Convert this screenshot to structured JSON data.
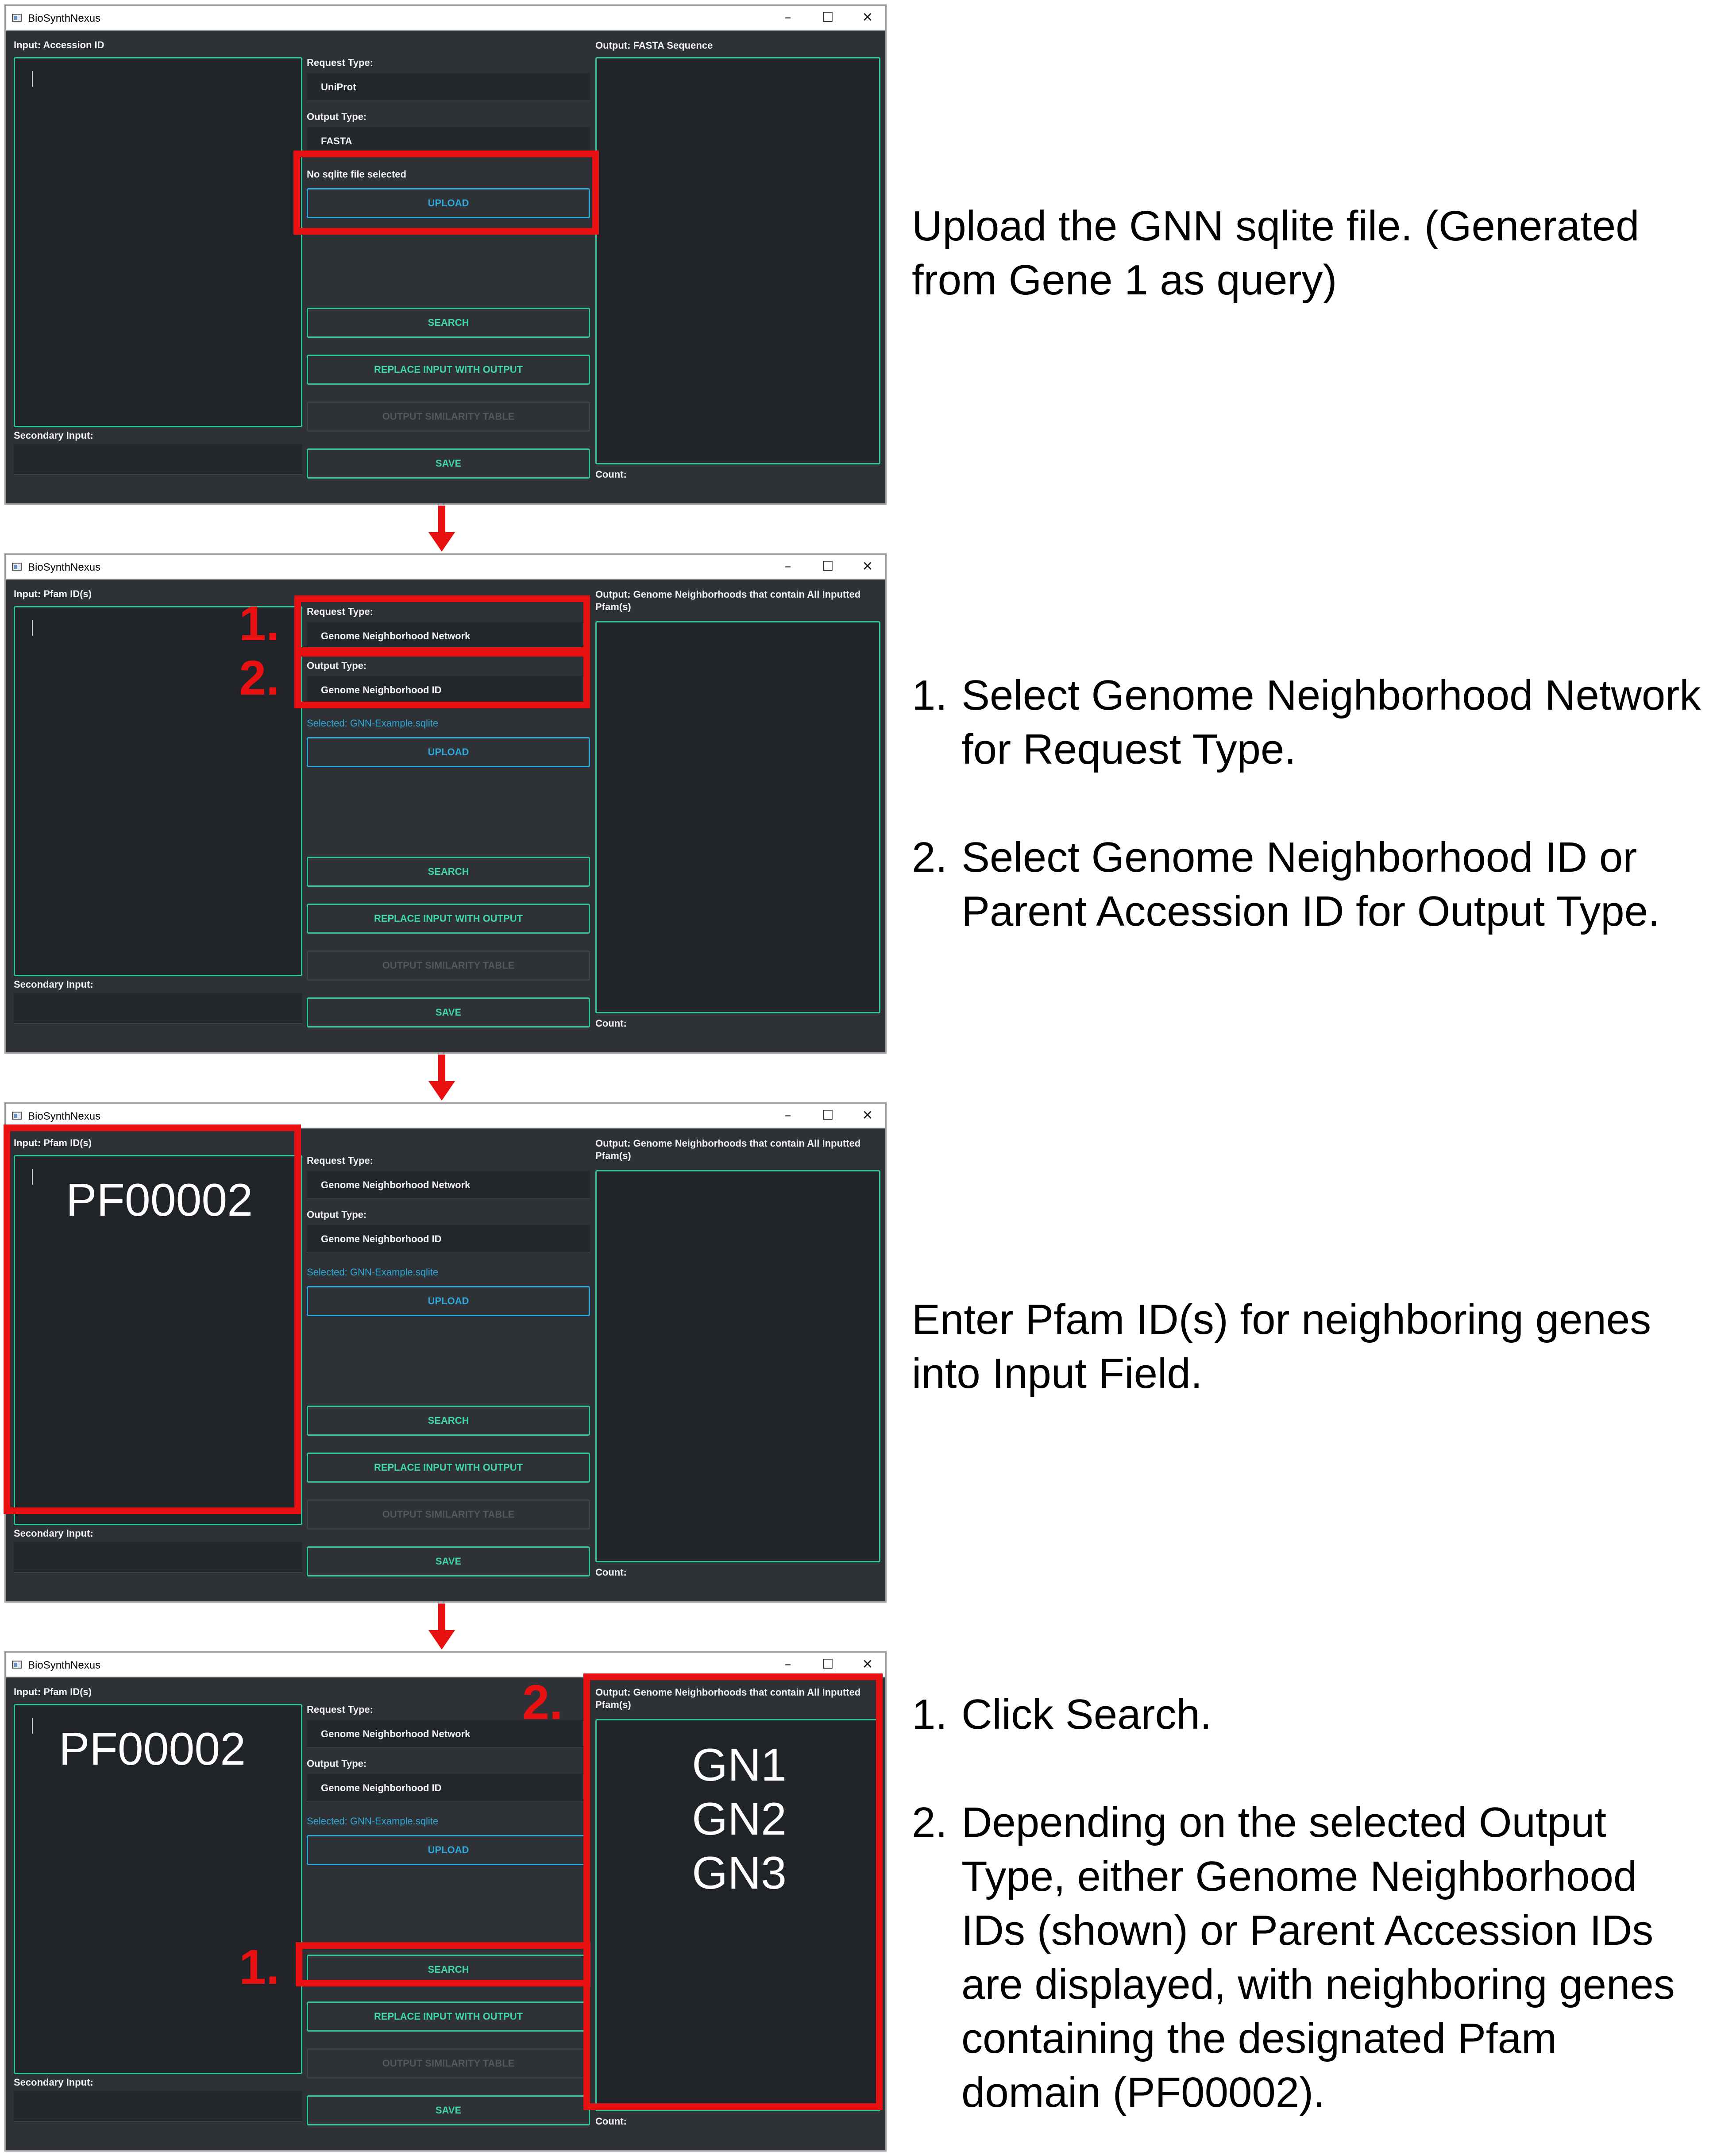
{
  "app_title": "BioSynthNexus",
  "window_controls": {
    "minimize": "–",
    "maximize": "☐",
    "close": "✕"
  },
  "labels": {
    "request_type": "Request Type:",
    "output_type": "Output Type:",
    "secondary_input": "Secondary Input:",
    "count": "Count:"
  },
  "buttons": {
    "upload": "UPLOAD",
    "search": "SEARCH",
    "replace": "REPLACE INPUT WITH OUTPUT",
    "similarity": "OUTPUT SIMILARITY TABLE",
    "save": "SAVE"
  },
  "panels": [
    {
      "input_label": "Input: Accession ID",
      "request_value": "UniProt",
      "output_value": "FASTA",
      "file_status": "No sqlite file selected",
      "output_label": "Output: FASTA Sequence",
      "instruction": "Upload the GNN sqlite file. (Generated from Gene 1 as query)"
    },
    {
      "input_label": "Input: Pfam ID(s)",
      "request_value": "Genome Neighborhood Network",
      "output_value": "Genome Neighborhood ID",
      "file_status": "Selected: GNN-Example.sqlite",
      "output_label": "Output: Genome Neighborhoods that contain All Inputted Pfam(s)",
      "markers": [
        "1.",
        "2."
      ],
      "instructions": [
        {
          "num": "1.",
          "text": "Select Genome Neighborhood Network for Request Type."
        },
        {
          "num": "2.",
          "text": "Select Genome Neighborhood ID or Parent Accession ID for Output Type."
        }
      ]
    },
    {
      "input_label": "Input: Pfam ID(s)",
      "request_value": "Genome Neighborhood Network",
      "output_value": "Genome Neighborhood ID",
      "file_status": "Selected: GNN-Example.sqlite",
      "output_label": "Output: Genome Neighborhoods that contain All Inputted Pfam(s)",
      "input_text": "PF00002",
      "instruction": "Enter Pfam ID(s) for neighboring genes into Input Field."
    },
    {
      "input_label": "Input: Pfam ID(s)",
      "request_value": "Genome Neighborhood Network",
      "output_value": "Genome Neighborhood ID",
      "file_status": "Selected: GNN-Example.sqlite",
      "output_label": "Output: Genome Neighborhoods that contain All Inputted Pfam(s)",
      "input_text": "PF00002",
      "output_items": [
        "GN1",
        "GN2",
        "GN3"
      ],
      "markers": [
        "1.",
        "2."
      ],
      "instructions": [
        {
          "num": "1.",
          "text": "Click Search."
        },
        {
          "num": "2.",
          "text": "Depending on the selected Output Type, either Genome Neighborhood IDs (shown) or Parent Accession IDs are displayed, with neighboring genes containing the designated Pfam domain (PF00002)."
        }
      ]
    }
  ],
  "arrow_icon": "down-arrow-icon",
  "colors": {
    "accent_green": "#30c79a",
    "accent_blue": "#2ea8d8",
    "highlight_red": "#e81010",
    "window_bg": "#2e3236"
  }
}
